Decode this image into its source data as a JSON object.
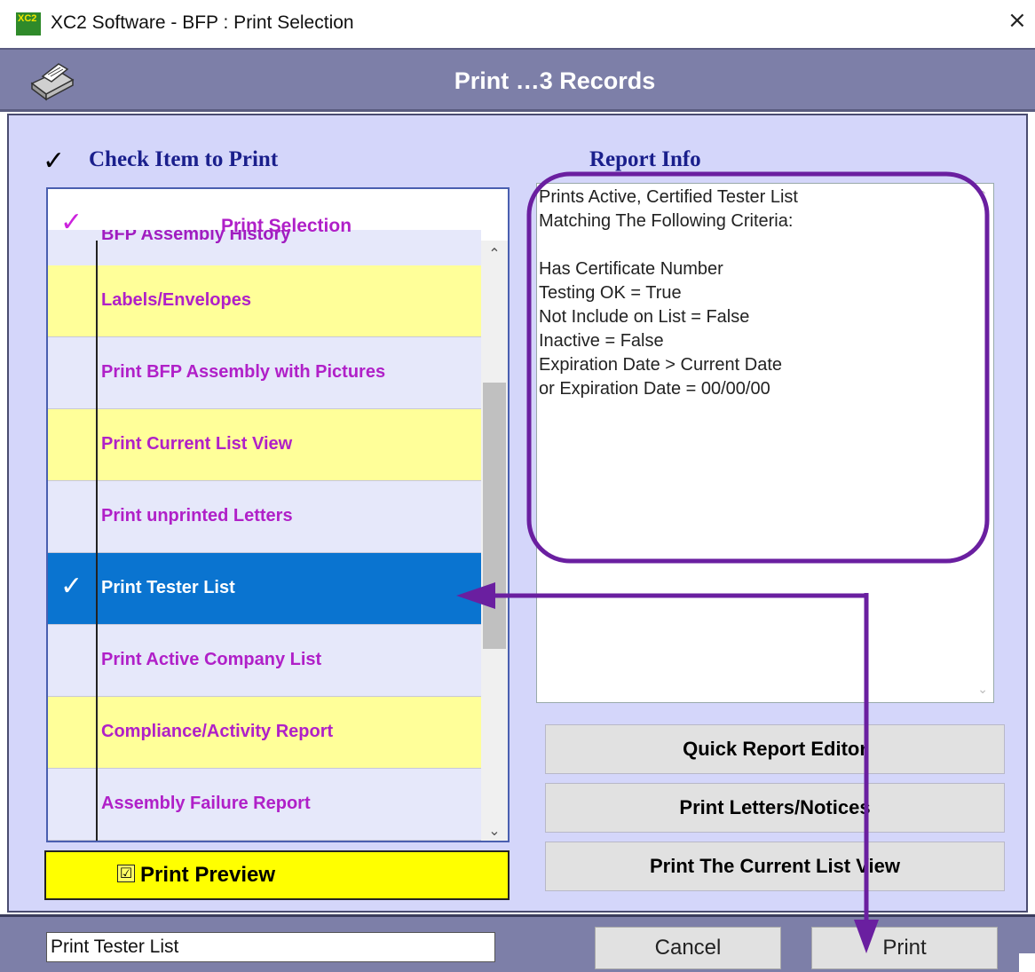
{
  "window": {
    "title": "XC2 Software - BFP : Print Selection",
    "icon_text": "XC2",
    "close_glyph": "×"
  },
  "header": {
    "title": "Print …3 Records",
    "icon": "printer-icon"
  },
  "left": {
    "section_title": "Check Item to Print",
    "check_glyph": "✓",
    "list_header_title": "Print Selection",
    "cut_item": "BFP Assembly History",
    "items": [
      {
        "label": "Labels/Envelopes",
        "selected": false,
        "bg": "#ffff99"
      },
      {
        "label": "Print BFP Assembly with Pictures",
        "selected": false,
        "bg": "#e6e8fa"
      },
      {
        "label": "Print Current List View",
        "selected": false,
        "bg": "#ffff99"
      },
      {
        "label": "Print unprinted  Letters",
        "selected": false,
        "bg": "#e6e8fa"
      },
      {
        "label": "Print Tester List",
        "selected": true,
        "bg": "#0a74d0"
      },
      {
        "label": "Print Active Company List",
        "selected": false,
        "bg": "#e6e8fa"
      },
      {
        "label": "Compliance/Activity  Report",
        "selected": false,
        "bg": "#ffff99"
      },
      {
        "label": "Assembly Failure Report",
        "selected": false,
        "bg": "#e6e8fa"
      }
    ],
    "scroll_up": "⌃",
    "scroll_down": "⌄",
    "preview_check": "☑",
    "preview_label": "Print Preview"
  },
  "right": {
    "section_title": "Report Info",
    "info_lines": [
      "Prints Active, Certified Tester List",
      "Matching The Following Criteria:",
      "",
      "Has Certificate Number",
      "Testing OK = True",
      "Not Include on List = False",
      "Inactive = False",
      "Expiration Date > Current Date",
      "or Expiration Date = 00/00/00"
    ],
    "buttons": {
      "quick_report_editor": "Quick Report Editor",
      "print_letters": "Print Letters/Notices",
      "print_list_view": "Print The Current List View"
    }
  },
  "footer": {
    "input_value": "Print Tester List",
    "cancel_label": "Cancel",
    "print_label": "Print"
  },
  "colors": {
    "accent_purple": "#6a1fa0",
    "selected_blue": "#0a74d0",
    "item_text": "#b020c8",
    "header_bg": "#7d7fa8"
  }
}
